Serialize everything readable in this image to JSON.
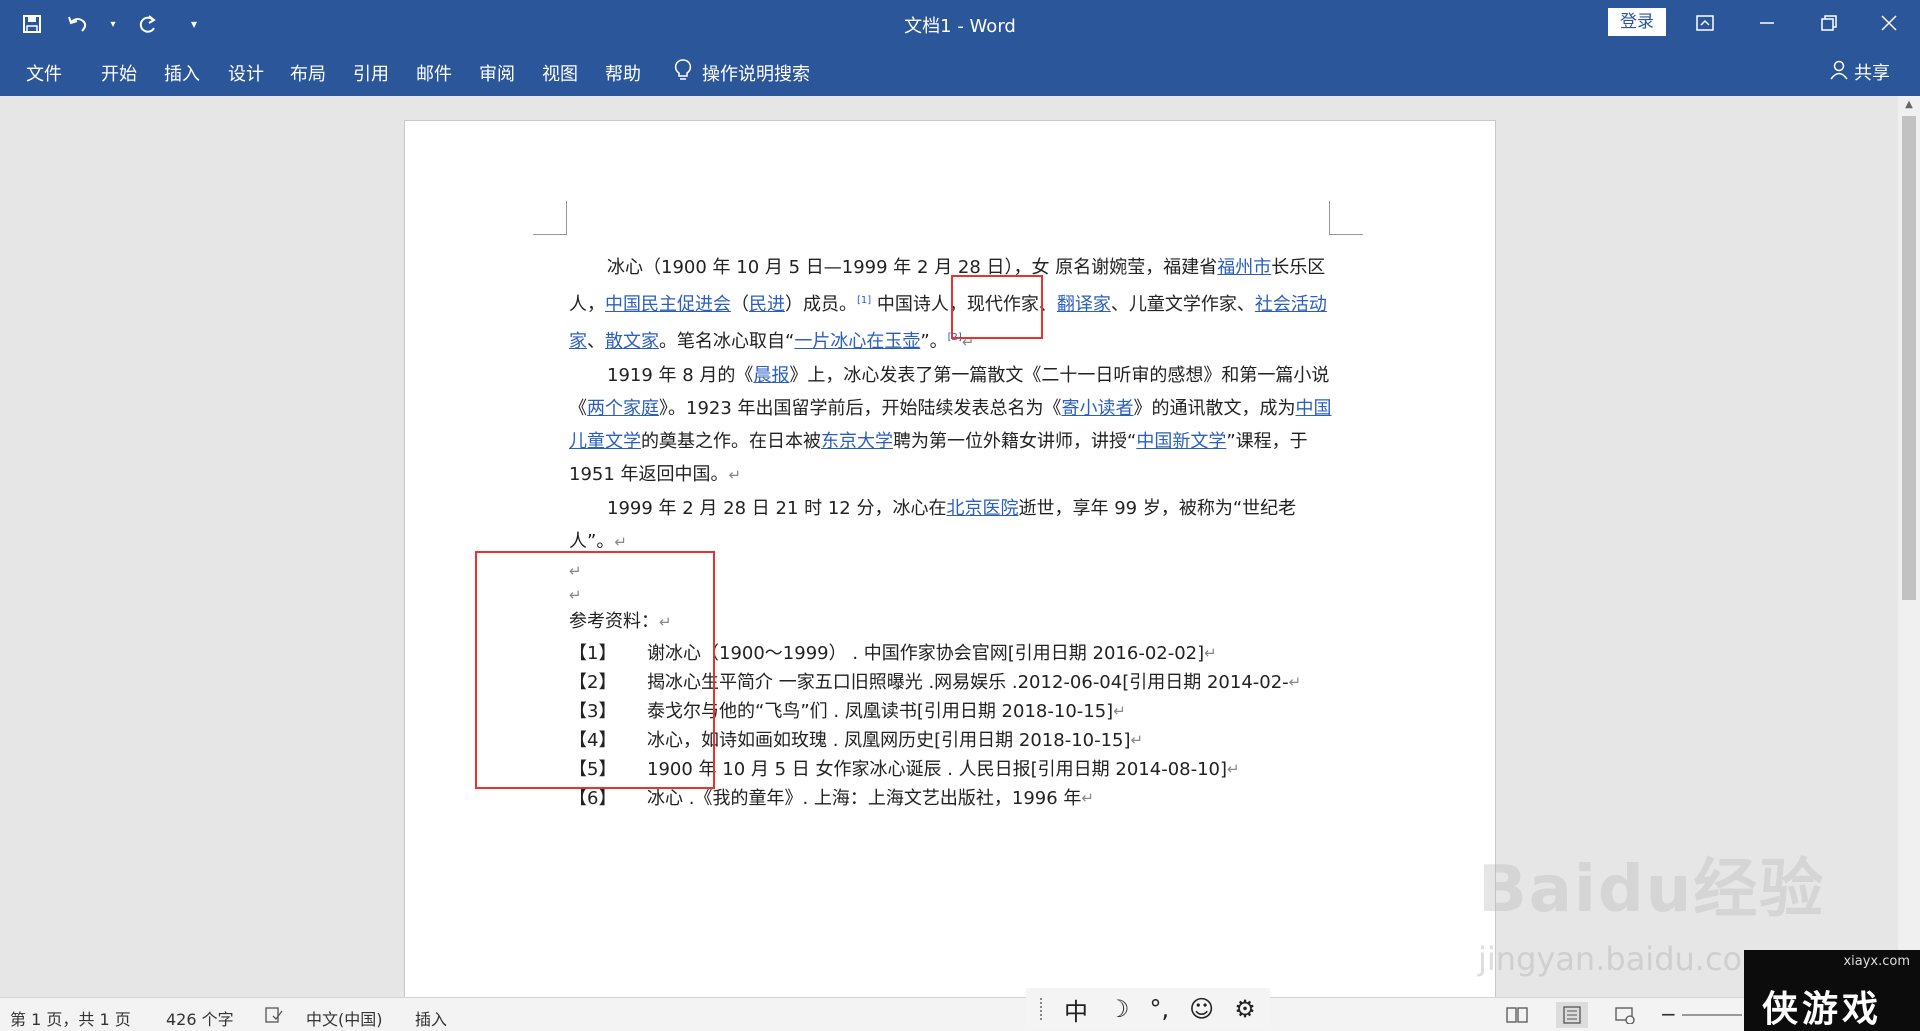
{
  "window": {
    "title": "文档1  -  Word",
    "login_label": "登录"
  },
  "qat": {
    "save": "save-icon",
    "undo": "undo-icon",
    "redo": "redo-icon",
    "customize": "▾"
  },
  "ribbon": {
    "tabs": [
      "文件",
      "开始",
      "插入",
      "设计",
      "布局",
      "引用",
      "邮件",
      "审阅",
      "视图",
      "帮助"
    ],
    "tellme": "操作说明搜索",
    "share": "共享"
  },
  "document": {
    "p1": {
      "t1": "冰心（1900 年 10 月 5 日—1999 年 2 月 28 日）",
      "t2": "，女   原名谢婉莹，福建省",
      "l1": "福州市",
      "t3": "长乐区人，",
      "l2": "中国民主促进会",
      "t4": "（",
      "l3": "民进",
      "t5": "）成员。",
      "s1": "[1]",
      "t6": " 中国诗人，现代作家、",
      "l4": "翻译家",
      "t7": "、儿童文学作家、",
      "l5": "社会活动家",
      "t8": "、",
      "l6": "散文家",
      "t9": "。笔名冰心取自“",
      "l7": "一片冰心在玉壶",
      "t10": "”。",
      "s2": "[2]"
    },
    "p2": {
      "t1": "1919 年 8 月的《",
      "l1": "晨报",
      "t2": "》上，冰心发表了第一篇散文《二十一日听审的感想》和第一篇小说《",
      "l2": "两个家庭",
      "t3": "》。1923 年出国留学前后，开始陆续发表总名为《",
      "l3": "寄小读者",
      "t4": "》的通讯散文，成为",
      "l4": "中国儿童文学",
      "t5": "的奠基之作。在日本被",
      "l5": "东京大学",
      "t6": "聘为第一位外籍女讲师，讲授“",
      "l6": "中国新文学",
      "t7": "”课程，于 1951 年返回中国。"
    },
    "p3": {
      "t1": "1999 年 2 月 28 日 21 时 12 分，冰心在",
      "l1": "北京医院",
      "t2": "逝世，享年 99 岁，被称为“世纪老人”。"
    },
    "refs_heading": "参考资料：",
    "refs": [
      {
        "num": "【1】",
        "text": "谢冰心（1900～1999）  . 中国作家协会官网[引用日期 2016-02-02]"
      },
      {
        "num": "【2】",
        "text": "揭冰心生平简介 一家五口旧照曝光  .网易娱乐 .2012-06-04[引用日期 2014-02-"
      },
      {
        "num": "【3】",
        "text": "泰戈尔与他的“飞鸟”们   . 凤凰读书[引用日期 2018-10-15]"
      },
      {
        "num": "【4】",
        "text": "冰心，如诗如画如玫瑰   . 凤凰网历史[引用日期 2018-10-15]"
      },
      {
        "num": "【5】",
        "text": "1900 年 10 月 5 日 女作家冰心诞辰   . 人民日报[引用日期 2014-08-10]"
      },
      {
        "num": "【6】",
        "text": "冰心 .《我的童年》. 上海：上海文艺出版社，1996 年"
      }
    ],
    "return_mark": "↵"
  },
  "ime": {
    "mode": "中",
    "moon": "☽",
    "punct": "°,",
    "emoji": "☺",
    "settings": "⚙"
  },
  "status": {
    "page": "第 1 页，共 1 页",
    "words": "426 个字",
    "language": "中文(中国)",
    "mode": "插入"
  },
  "watermark": {
    "baidu": "Baidu经验",
    "baidu_url": "jingyan.baidu.com",
    "site": "xiayx.com",
    "site_logo": "侠游戏"
  },
  "colors": {
    "accent": "#2b579a",
    "link": "#2b5fbd",
    "highlight_box": "#e8332f"
  }
}
